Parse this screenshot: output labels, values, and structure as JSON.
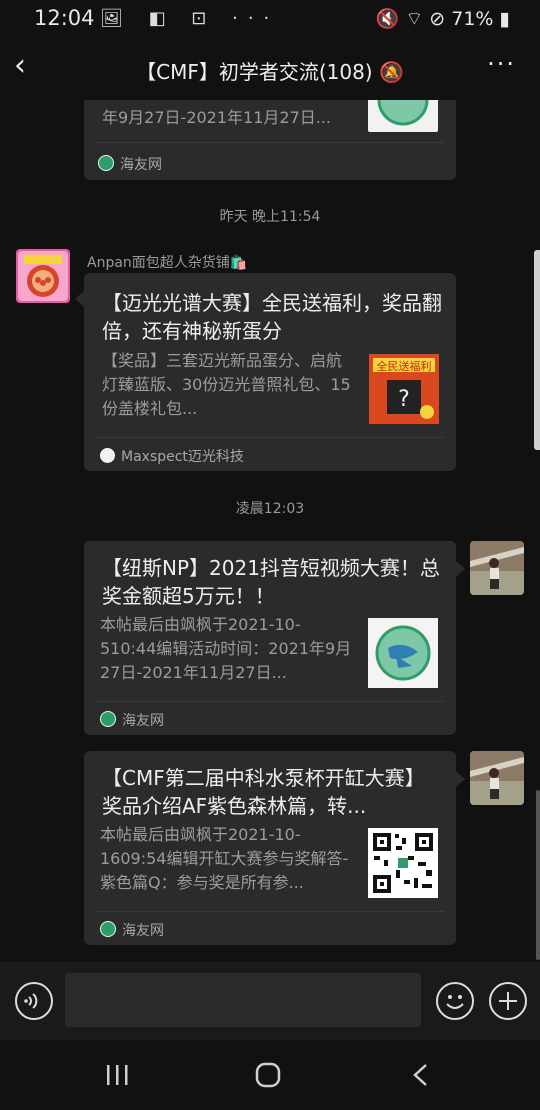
{
  "status_bar": {
    "time": "12:04",
    "left_icons": "🖼 ◧ ⊡ ···",
    "battery": "🔇 ⌔ ⊘ 71% ▮"
  },
  "header": {
    "back": "‹",
    "title": "【CMF】初学者交流(108) 🔕",
    "more": "···"
  },
  "messages": [
    {
      "desc": "年9月27日-2021年11月27日...",
      "source": "海友网"
    },
    {
      "timestamp": "昨天 晚上11:54",
      "sender": "Anpan面包超人杂货铺🛍️",
      "title": "【迈光光谱大赛】全民送福利，奖品翻倍，还有神秘新蛋分",
      "desc": "【奖品】三套迈光新品蛋分、启航灯臻蓝版、30份迈光普照礼包、15份盖楼礼包...",
      "source": "Maxspect迈光科技",
      "thumb_text": "全民送福利"
    },
    {
      "timestamp": "凌晨12:03",
      "title": "【纽斯NP】2021抖音短视频大赛！总奖金额超5万元！！",
      "desc": "本帖最后由飒枫于2021-10-510:44编辑活动时间：2021年9月27日-2021年11月27日...",
      "source": "海友网"
    },
    {
      "title": "【CMF第二届中科水泵杯开缸大赛】奖品介绍AF紫色森林篇，转...",
      "desc": "本帖最后由飒枫于2021-10-1609:54编辑开缸大赛参与奖解答-紫色篇Q：参与奖是所有参...",
      "source": "海友网"
    }
  ],
  "colors": {
    "background": "#111111",
    "card": "#2b2b2b",
    "accent_green": "#2f9c6a"
  }
}
